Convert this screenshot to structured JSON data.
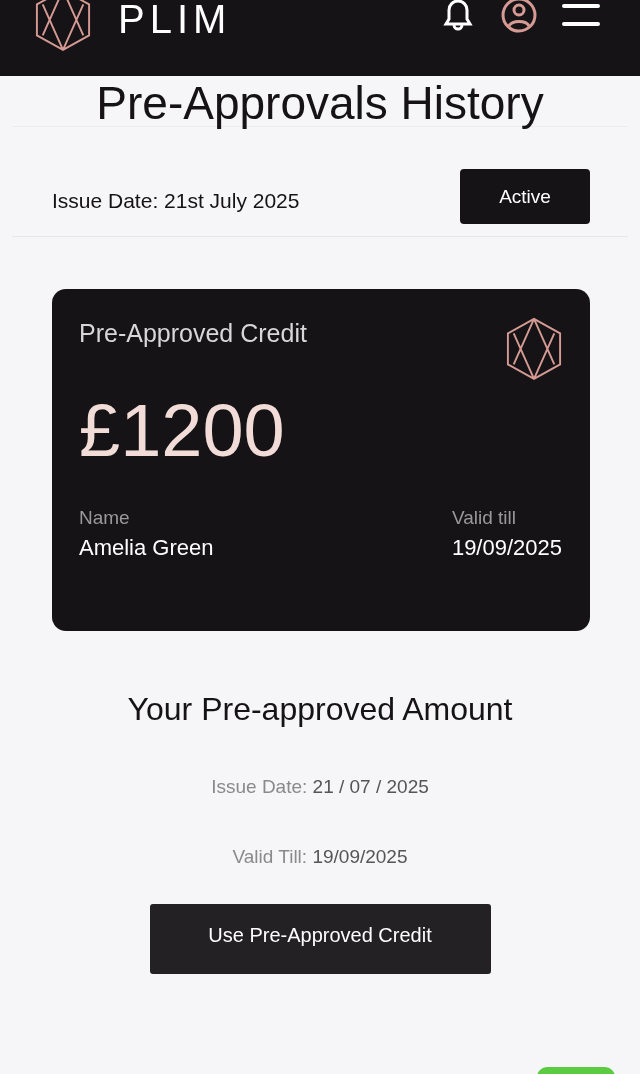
{
  "header": {
    "brand": "PLIM"
  },
  "title": "Pre-Approvals History",
  "approval": {
    "issue_date": "Issue Date: 21st July 2025",
    "status": "Active"
  },
  "card": {
    "label": "Pre-Approved Credit",
    "amount": "£1200",
    "name_label": "Name",
    "name": "Amelia Green",
    "valid_label": "Valid till",
    "valid_date": "19/09/2025"
  },
  "summary": {
    "heading": "Your Pre-approved Amount",
    "issue_label": "Issue Date:",
    "issue_value": "21 / 07 / 2025",
    "valid_label": "Valid Till:",
    "valid_value": "19/09/2025"
  },
  "action": {
    "label": "Use Pre-Approved Credit"
  }
}
